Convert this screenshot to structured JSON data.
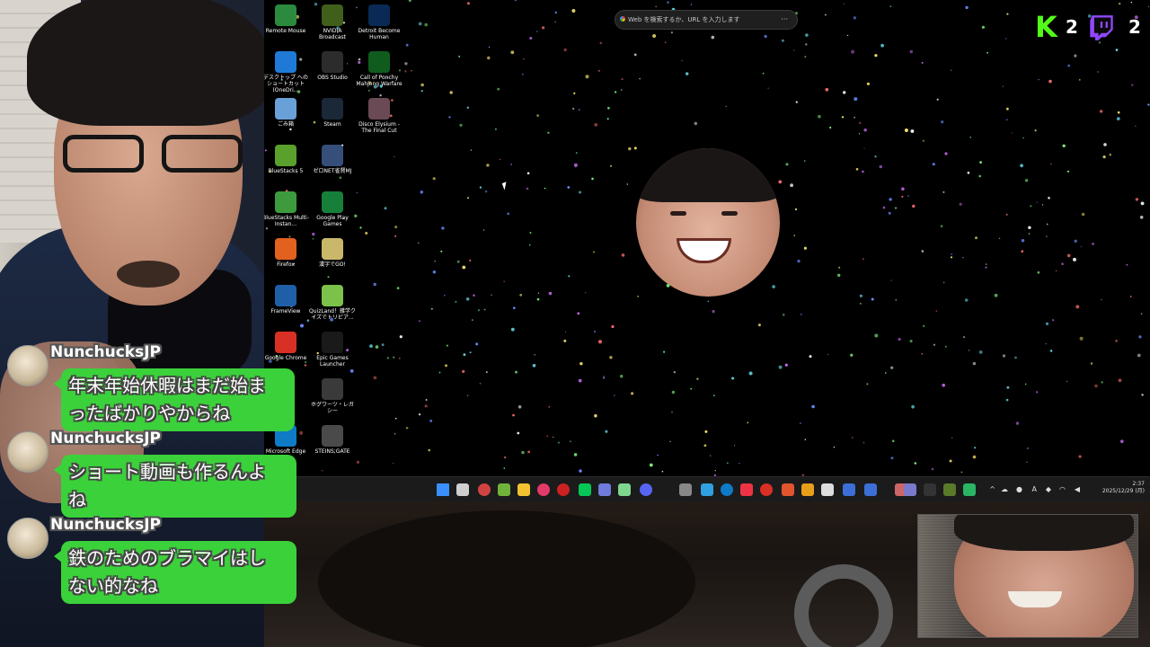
{
  "search": {
    "placeholder": "Web を検索するか、URL を入力します",
    "menu": "···"
  },
  "counters": {
    "kick": "2",
    "twitch": "2"
  },
  "desktop_icons": [
    {
      "label": "Remote Mouse",
      "color": "#2b8a3e"
    },
    {
      "label": "NVIDIA Broadcast",
      "color": "#3f5f1a"
    },
    {
      "label": "Detroit Become Human",
      "color": "#0a2a55"
    },
    {
      "label": "デスクトップ へのショートカット (OneDri...",
      "color": "#1e7ad6"
    },
    {
      "label": "OBS Studio",
      "color": "#2c2c2c"
    },
    {
      "label": "Call of Ponchy Mahjong Warfare",
      "color": "#0f5c1e"
    },
    {
      "label": "ごみ箱",
      "color": "#6aa0d8"
    },
    {
      "label": "Steam",
      "color": "#1b2838"
    },
    {
      "label": "Disco Elysium - The Final Cut",
      "color": "#6a4a55"
    },
    {
      "label": "BlueStacks 5",
      "color": "#5aa02c"
    },
    {
      "label": "ゼロNET雀賢MJ",
      "color": "#354f7a"
    },
    {
      "label": "BlueStacks Multi-Instan...",
      "color": "#3d9b3d"
    },
    {
      "label": "Google Play Games",
      "color": "#16803a"
    },
    {
      "label": "Firefox",
      "color": "#e2611f"
    },
    {
      "label": "漢字でGO!",
      "color": "#c9b86a"
    },
    {
      "label": "FrameView",
      "color": "#1f5fa8"
    },
    {
      "label": "QuizLand！雑学クイズでトリビア...",
      "color": "#7cc24a"
    },
    {
      "label": "Google Chrome",
      "color": "#d93025"
    },
    {
      "label": "Epic Games Launcher",
      "color": "#1a1a1a"
    },
    {
      "label": "ホグワーツ・レガシー",
      "color": "#3a3a3a"
    },
    {
      "label": "Microsoft Edge",
      "color": "#0f7ac6"
    },
    {
      "label": "STEINS;GATE",
      "color": "#4a4a4a"
    }
  ],
  "taskbar": {
    "time": "2:37",
    "date": "2025/12/29 (月)",
    "ime": "A"
  },
  "chat": [
    {
      "user": "NunchucksJP",
      "line1": "年末年始休暇はまだ始ま",
      "line2": "ったばかりやからね"
    },
    {
      "user": "NunchucksJP",
      "line1": "ショート動画も作るんよ",
      "line2": "ね"
    },
    {
      "user": "NunchucksJP",
      "line1": "鉄のためのブラマイはし",
      "line2": "ない的なね"
    }
  ]
}
